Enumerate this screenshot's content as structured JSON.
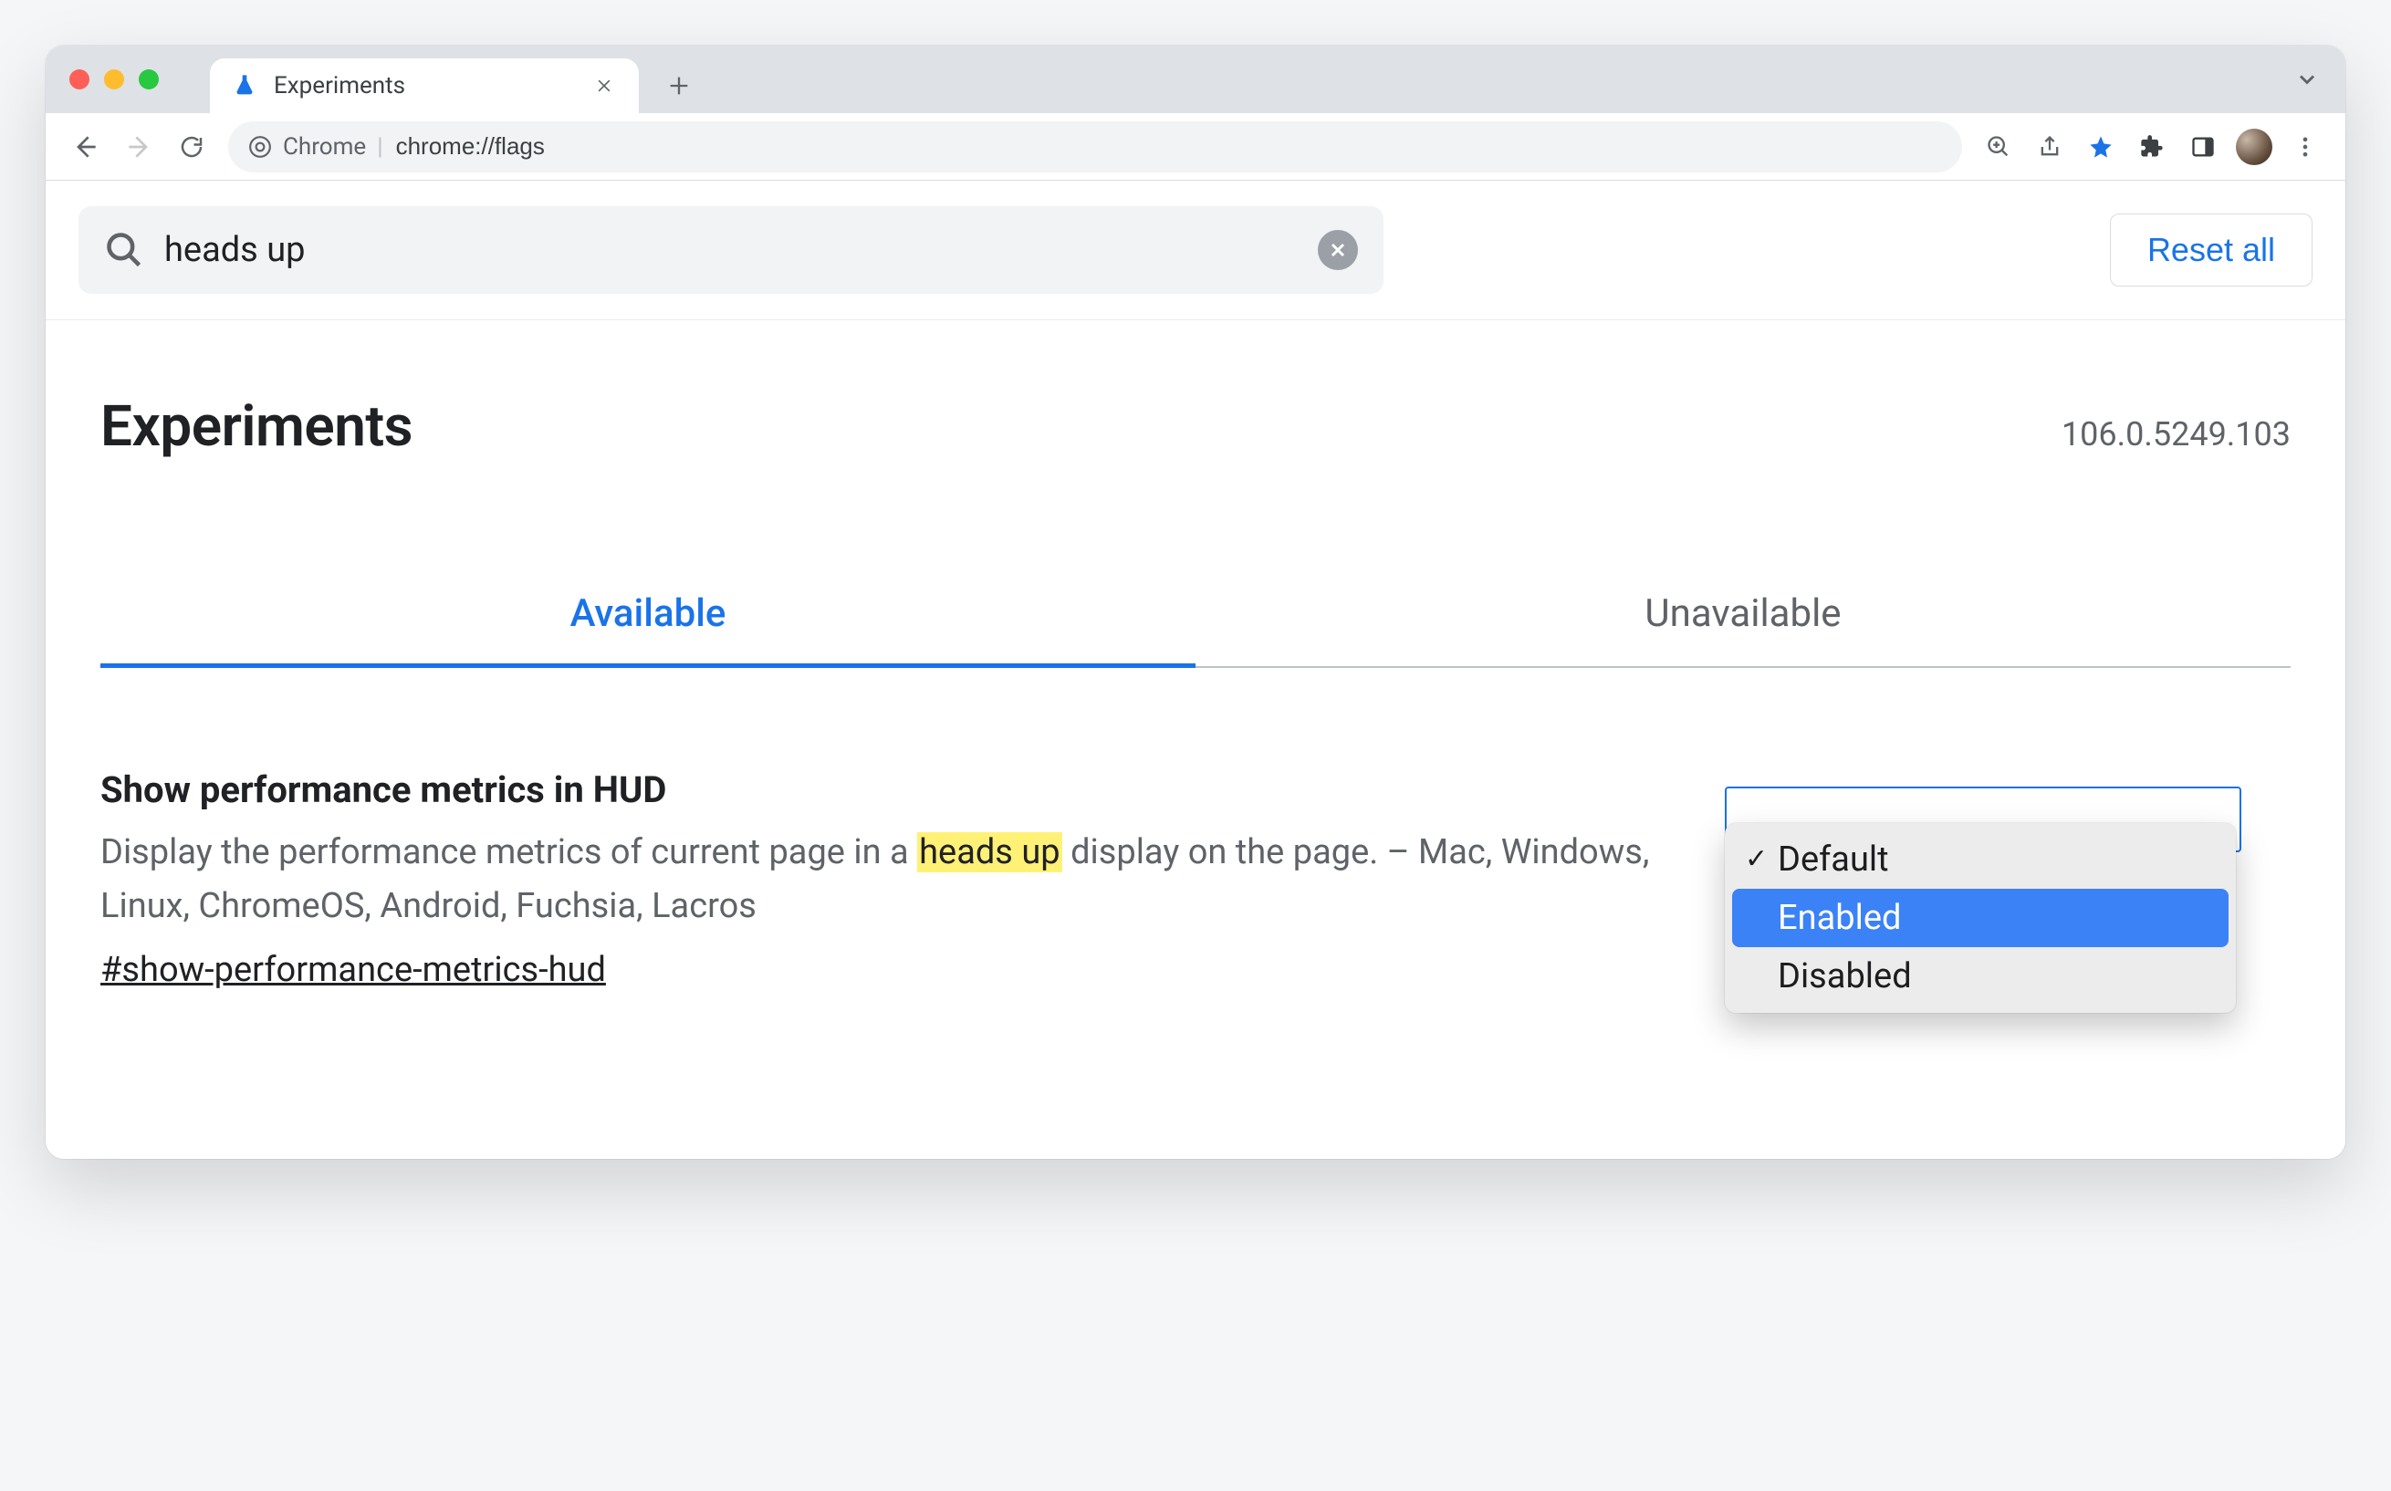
{
  "browser": {
    "tab_title": "Experiments",
    "omnibox_label": "Chrome",
    "omnibox_url": "chrome://flags"
  },
  "search": {
    "value": "heads up",
    "reset_label": "Reset all"
  },
  "heading": "Experiments",
  "version": "106.0.5249.103",
  "tabs": {
    "available": "Available",
    "unavailable": "Unavailable"
  },
  "experiment": {
    "title": "Show performance metrics in HUD",
    "desc_before": "Display the performance metrics of current page in a ",
    "desc_highlight": "heads up",
    "desc_after": " display on the page. – Mac, Windows, Linux, ChromeOS, Android, Fuchsia, Lacros",
    "link": "#show-performance-metrics-hud"
  },
  "select": {
    "options": [
      "Default",
      "Enabled",
      "Disabled"
    ],
    "checked": "Default",
    "highlighted": "Enabled"
  }
}
